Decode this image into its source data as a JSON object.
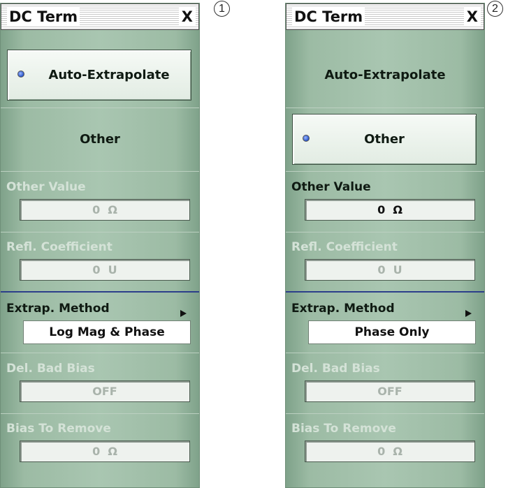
{
  "callouts": [
    "1",
    "2"
  ],
  "panels": [
    {
      "title": "DC Term",
      "close": "X",
      "auto_extrapolate": "Auto-Extrapolate",
      "other": "Other",
      "other_value_label": "Other Value",
      "other_value": "0  Ω",
      "refl_label": "Refl. Coefficient",
      "refl_value": "0  U",
      "extrap_label": "Extrap. Method",
      "extrap_value": "Log Mag & Phase",
      "del_bad_bias_label": "Del. Bad Bias",
      "del_bad_bias_value": "OFF",
      "bias_remove_label": "Bias To Remove",
      "bias_remove_value": "0  Ω"
    },
    {
      "title": "DC Term",
      "close": "X",
      "auto_extrapolate": "Auto-Extrapolate",
      "other": "Other",
      "other_value_label": "Other Value",
      "other_value": "0  Ω",
      "refl_label": "Refl. Coefficient",
      "refl_value": "0  U",
      "extrap_label": "Extrap. Method",
      "extrap_value": "Phase Only",
      "del_bad_bias_label": "Del. Bad Bias",
      "del_bad_bias_value": "OFF",
      "bias_remove_label": "Bias To Remove",
      "bias_remove_value": "0  Ω"
    }
  ]
}
